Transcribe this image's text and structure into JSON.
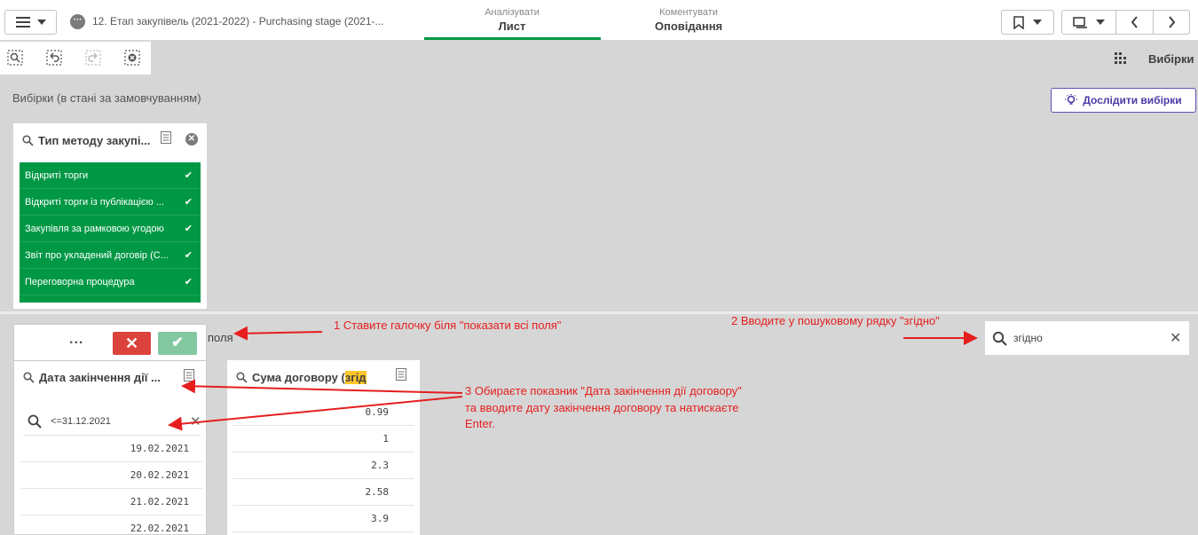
{
  "topbar": {
    "app_title": "12. Етап закупівель (2021-2022) - Purchasing stage (2021-...",
    "tabs": [
      {
        "sub": "Аналізувати",
        "main": "Лист"
      },
      {
        "sub": "Коментувати",
        "main": "Оповідання"
      }
    ]
  },
  "toolbar": {
    "selections_label": "Вибірки"
  },
  "section": {
    "title": "Вибірки (в стані за замовчуванням)",
    "explore_button": "Дослідити вибірки"
  },
  "filter_method": {
    "title": "Тип методу закупі...",
    "items": [
      "Відкриті торги",
      "Відкриті торги із публікацією ...",
      "Закупівля за рамковою угодою",
      "Звіт про укладений договір (С...",
      "Переговорна процедура"
    ]
  },
  "selection_bar": {
    "dots": "...",
    "cancel": "✕",
    "confirm": "✔",
    "show_fields_text": "поля"
  },
  "filter_date": {
    "title": "Дата закінчення дії ...",
    "search_value": "<=31.12.2021",
    "values": [
      "19.02.2021",
      "20.02.2021",
      "21.02.2021",
      "22.02.2021"
    ]
  },
  "filter_sum": {
    "title_prefix": "Сума договору (",
    "title_highlight": "згід",
    "values": [
      "0.99",
      "1",
      "2.3",
      "2.58",
      "3.9"
    ]
  },
  "global_search": {
    "value": "згідно"
  },
  "annotations": {
    "step1": "1 Ставите галочку біля \"показати всі поля\"",
    "step2": "2 Вводите у пошуковому рядку \"згідно\"",
    "step3_line1": "3 Обираєте показник \"Дата закінчення дії договору\"",
    "step3_line2": "та вводите дату закінчення договору та натискаєте",
    "step3_line3": "Enter."
  },
  "colors": {
    "accent_green": "#009845",
    "annotation_red": "#e61e1e",
    "explore_purple": "#4a3aa8",
    "cancel_red": "#dc423c",
    "highlight_yellow": "#ffc72a"
  }
}
